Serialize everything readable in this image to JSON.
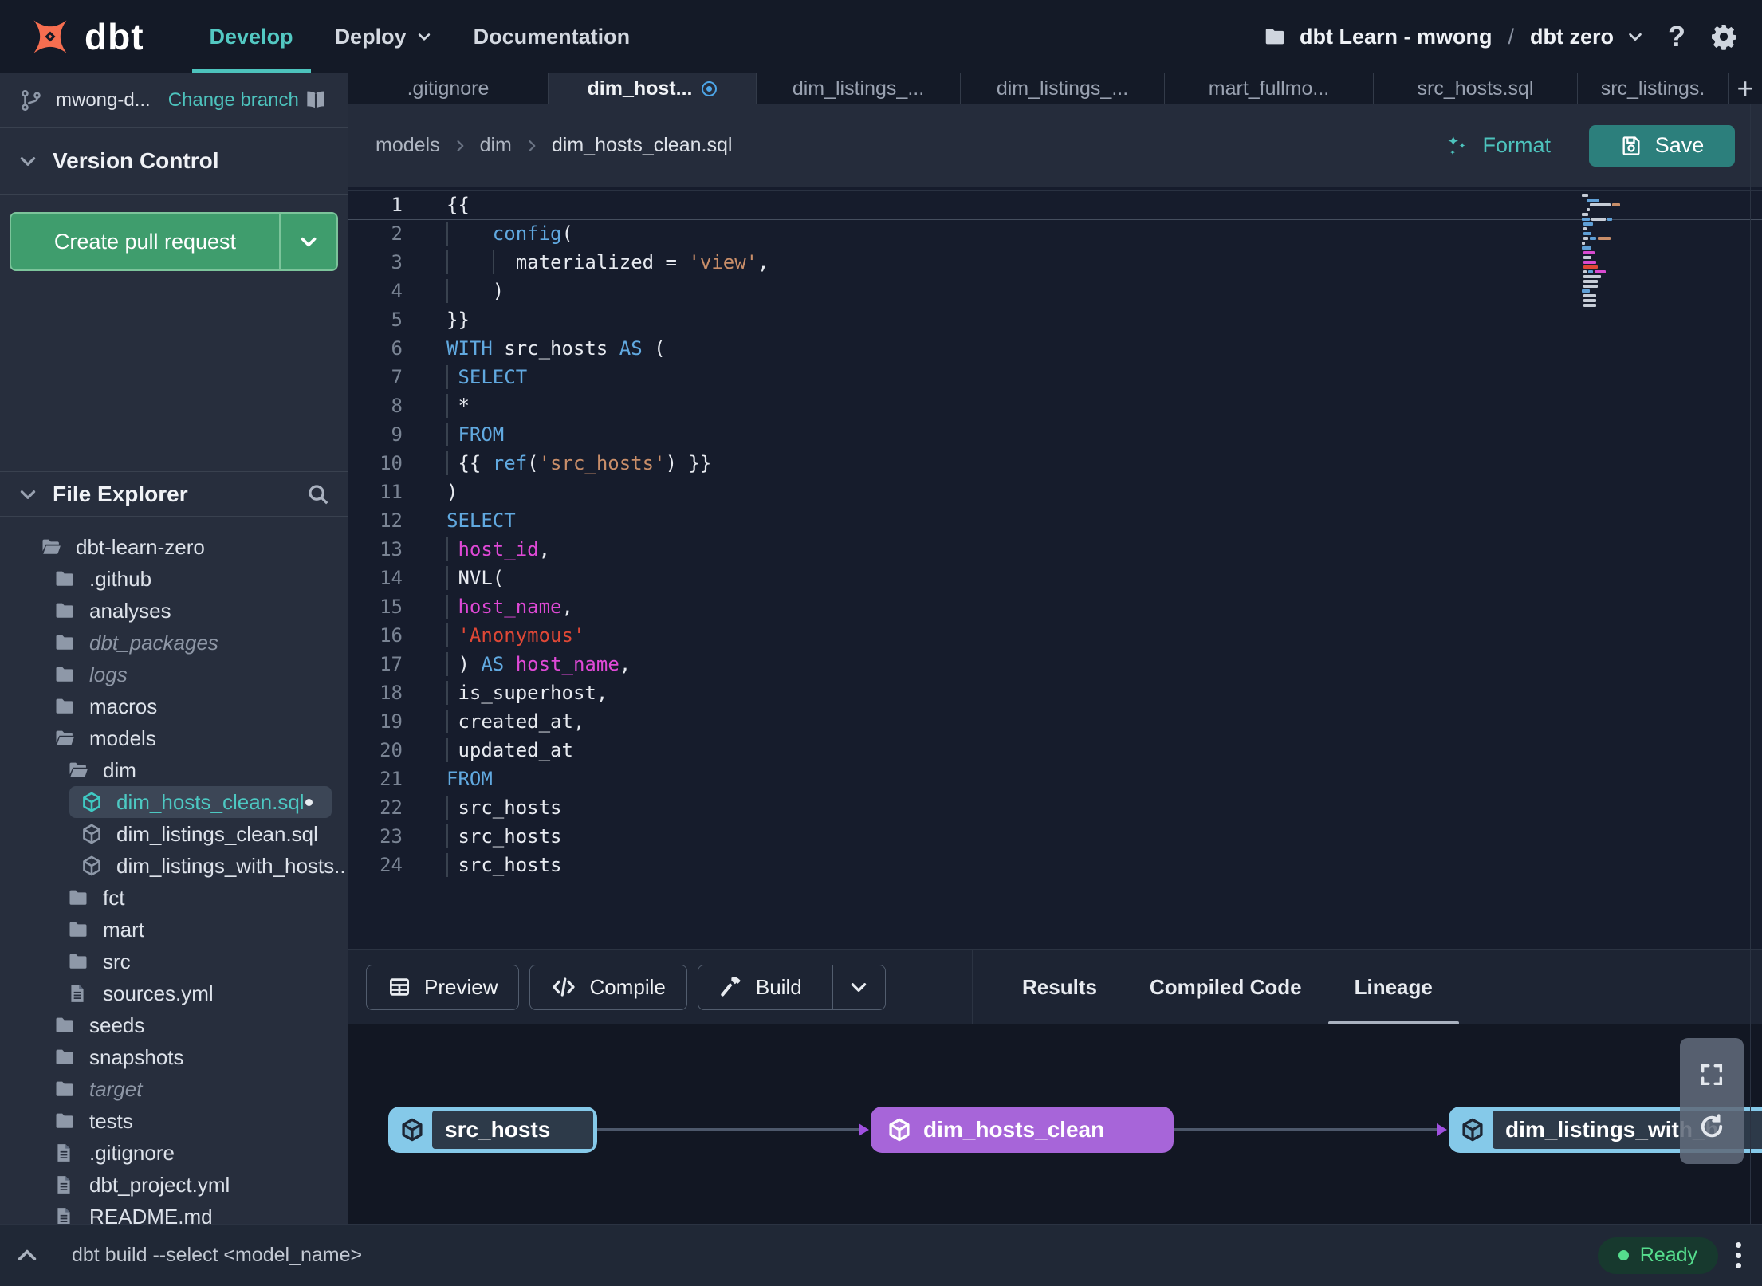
{
  "navbar": {
    "logo_text": "dbt",
    "nav_items": [
      "Develop",
      "Deploy",
      "Documentation"
    ],
    "active_nav": "Develop",
    "project_label": "dbt Learn - mwong",
    "project_separator": "/",
    "environment_label": "dbt zero"
  },
  "sidebar": {
    "branch": {
      "name": "mwong-d...",
      "change_link": "Change branch"
    },
    "version_control_header": "Version Control",
    "create_pr_label": "Create pull request",
    "file_explorer_header": "File Explorer",
    "tree": [
      {
        "label": "dbt-learn-zero",
        "type": "folder-open",
        "indent": 0
      },
      {
        "label": ".github",
        "type": "folder",
        "indent": 1
      },
      {
        "label": "analyses",
        "type": "folder",
        "indent": 1
      },
      {
        "label": "dbt_packages",
        "type": "folder",
        "indent": 1,
        "muted": true
      },
      {
        "label": "logs",
        "type": "folder",
        "indent": 1,
        "muted": true
      },
      {
        "label": "macros",
        "type": "folder",
        "indent": 1
      },
      {
        "label": "models",
        "type": "folder-open",
        "indent": 1
      },
      {
        "label": "dim",
        "type": "folder-open",
        "indent": 2
      },
      {
        "label": "dim_hosts_clean.sql",
        "type": "model",
        "indent": 3,
        "selected": true,
        "modified": true
      },
      {
        "label": "dim_listings_clean.sql",
        "type": "model",
        "indent": 3
      },
      {
        "label": "dim_listings_with_hosts...",
        "type": "model",
        "indent": 3
      },
      {
        "label": "fct",
        "type": "folder",
        "indent": 2
      },
      {
        "label": "mart",
        "type": "folder",
        "indent": 2
      },
      {
        "label": "src",
        "type": "folder",
        "indent": 2
      },
      {
        "label": "sources.yml",
        "type": "file",
        "indent": 2
      },
      {
        "label": "seeds",
        "type": "folder",
        "indent": 1
      },
      {
        "label": "snapshots",
        "type": "folder",
        "indent": 1
      },
      {
        "label": "target",
        "type": "folder",
        "indent": 1,
        "muted": true
      },
      {
        "label": "tests",
        "type": "folder",
        "indent": 1
      },
      {
        "label": ".gitignore",
        "type": "file",
        "indent": 1
      },
      {
        "label": "dbt_project.yml",
        "type": "file",
        "indent": 1
      },
      {
        "label": "README.md",
        "type": "file",
        "indent": 1
      }
    ]
  },
  "tabs": [
    {
      "label": ".gitignore"
    },
    {
      "label": "dim_host...",
      "active": true,
      "modified": true
    },
    {
      "label": "dim_listings_..."
    },
    {
      "label": "dim_listings_..."
    },
    {
      "label": "mart_fullmo..."
    },
    {
      "label": "src_hosts.sql"
    },
    {
      "label": "src_listings."
    }
  ],
  "editor_header": {
    "breadcrumb": [
      "models",
      "dim",
      "dim_hosts_clean.sql"
    ],
    "format_label": "Format",
    "save_label": "Save"
  },
  "editor": {
    "active_line": 1,
    "lines": [
      {
        "n": 1,
        "t": [
          [
            "w",
            "{{"
          ]
        ],
        "g": []
      },
      {
        "n": 2,
        "t": [
          [
            "w",
            "    "
          ],
          [
            "k",
            "config"
          ],
          [
            "w",
            "("
          ]
        ],
        "g": [
          0
        ]
      },
      {
        "n": 3,
        "t": [
          [
            "w",
            "      materialized = "
          ],
          [
            "s",
            "'view'"
          ],
          [
            "w",
            ","
          ]
        ],
        "g": [
          0,
          4
        ]
      },
      {
        "n": 4,
        "t": [
          [
            "w",
            "    )"
          ]
        ],
        "g": [
          0
        ]
      },
      {
        "n": 5,
        "t": [
          [
            "w",
            "}}"
          ]
        ],
        "g": []
      },
      {
        "n": 6,
        "t": [
          [
            "k",
            "WITH"
          ],
          [
            "w",
            " src_hosts "
          ],
          [
            "k",
            "AS"
          ],
          [
            "w",
            " ("
          ]
        ],
        "g": []
      },
      {
        "n": 7,
        "t": [
          [
            "w",
            " "
          ],
          [
            "k",
            "SELECT"
          ]
        ],
        "g": [
          0
        ]
      },
      {
        "n": 8,
        "t": [
          [
            "w",
            " *"
          ]
        ],
        "g": [
          0
        ]
      },
      {
        "n": 9,
        "t": [
          [
            "w",
            " "
          ],
          [
            "k",
            "FROM"
          ]
        ],
        "g": [
          0
        ]
      },
      {
        "n": 10,
        "t": [
          [
            "w",
            " {{ "
          ],
          [
            "k",
            "ref"
          ],
          [
            "w",
            "("
          ],
          [
            "s",
            "'src_hosts'"
          ],
          [
            "w",
            ") }}"
          ]
        ],
        "g": [
          0
        ]
      },
      {
        "n": 11,
        "t": [
          [
            "w",
            ")"
          ]
        ],
        "g": []
      },
      {
        "n": 12,
        "t": [
          [
            "k",
            "SELECT"
          ]
        ],
        "g": []
      },
      {
        "n": 13,
        "t": [
          [
            "w",
            " "
          ],
          [
            "m",
            "host_id"
          ],
          [
            "w",
            ","
          ]
        ],
        "g": [
          0
        ]
      },
      {
        "n": 14,
        "t": [
          [
            "w",
            " NVL("
          ]
        ],
        "g": [
          0
        ]
      },
      {
        "n": 15,
        "t": [
          [
            "w",
            " "
          ],
          [
            "m",
            "host_name"
          ],
          [
            "w",
            ","
          ]
        ],
        "g": [
          0
        ]
      },
      {
        "n": 16,
        "t": [
          [
            "w",
            " "
          ],
          [
            "r",
            "'Anonymous'"
          ]
        ],
        "g": [
          0
        ]
      },
      {
        "n": 17,
        "t": [
          [
            "w",
            " ) "
          ],
          [
            "k",
            "AS"
          ],
          [
            "w",
            " "
          ],
          [
            "m",
            "host_name"
          ],
          [
            "w",
            ","
          ]
        ],
        "g": [
          0
        ]
      },
      {
        "n": 18,
        "t": [
          [
            "w",
            " is_superhost,"
          ]
        ],
        "g": [
          0
        ]
      },
      {
        "n": 19,
        "t": [
          [
            "w",
            " created_at,"
          ]
        ],
        "g": [
          0
        ]
      },
      {
        "n": 20,
        "t": [
          [
            "w",
            " updated_at"
          ]
        ],
        "g": [
          0
        ]
      },
      {
        "n": 21,
        "t": [
          [
            "k",
            "FROM"
          ]
        ],
        "g": []
      },
      {
        "n": 22,
        "t": [
          [
            "w",
            " src_hosts"
          ]
        ],
        "g": [
          0
        ]
      },
      {
        "n": 23,
        "t": [
          [
            "w",
            " src_hosts"
          ]
        ],
        "g": [
          0
        ]
      },
      {
        "n": 24,
        "t": [
          [
            "w",
            " src_hosts"
          ]
        ],
        "g": [
          0
        ]
      }
    ],
    "minimap": [
      {
        "indent": 0,
        "segs": [
          [
            "w",
            8
          ]
        ]
      },
      {
        "indent": 6,
        "segs": [
          [
            "b",
            16
          ]
        ]
      },
      {
        "indent": 10,
        "segs": [
          [
            "w",
            26
          ],
          [
            "o",
            10
          ]
        ]
      },
      {
        "indent": 6,
        "segs": [
          [
            "w",
            4
          ]
        ]
      },
      {
        "indent": 0,
        "segs": [
          [
            "w",
            8
          ]
        ]
      },
      {
        "indent": 0,
        "segs": [
          [
            "b",
            10
          ],
          [
            "w",
            18
          ],
          [
            "b",
            6
          ]
        ]
      },
      {
        "indent": 2,
        "segs": [
          [
            "b",
            12
          ]
        ]
      },
      {
        "indent": 2,
        "segs": [
          [
            "w",
            4
          ]
        ]
      },
      {
        "indent": 2,
        "segs": [
          [
            "b",
            10
          ]
        ]
      },
      {
        "indent": 2,
        "segs": [
          [
            "w",
            6
          ],
          [
            "b",
            8
          ],
          [
            "o",
            16
          ]
        ]
      },
      {
        "indent": 0,
        "segs": [
          [
            "w",
            4
          ]
        ]
      },
      {
        "indent": 0,
        "segs": [
          [
            "b",
            12
          ]
        ]
      },
      {
        "indent": 2,
        "segs": [
          [
            "m",
            14
          ]
        ]
      },
      {
        "indent": 2,
        "segs": [
          [
            "w",
            10
          ]
        ]
      },
      {
        "indent": 2,
        "segs": [
          [
            "m",
            16
          ]
        ]
      },
      {
        "indent": 2,
        "segs": [
          [
            "r",
            18
          ]
        ]
      },
      {
        "indent": 2,
        "segs": [
          [
            "w",
            4
          ],
          [
            "b",
            6
          ],
          [
            "m",
            14
          ]
        ]
      },
      {
        "indent": 2,
        "segs": [
          [
            "w",
            22
          ]
        ]
      },
      {
        "indent": 2,
        "segs": [
          [
            "w",
            18
          ]
        ]
      },
      {
        "indent": 2,
        "segs": [
          [
            "w",
            18
          ]
        ]
      },
      {
        "indent": 0,
        "segs": [
          [
            "b",
            10
          ]
        ]
      },
      {
        "indent": 2,
        "segs": [
          [
            "w",
            16
          ]
        ]
      },
      {
        "indent": 2,
        "segs": [
          [
            "w",
            16
          ]
        ]
      },
      {
        "indent": 2,
        "segs": [
          [
            "w",
            16
          ]
        ]
      }
    ]
  },
  "bottom_panel": {
    "buttons": [
      {
        "label": "Preview",
        "icon": "table-icon"
      },
      {
        "label": "Compile",
        "icon": "code-icon"
      },
      {
        "label": "Build",
        "icon": "hammer-icon",
        "split": true
      }
    ],
    "tabs": [
      "Results",
      "Compiled Code",
      "Lineage"
    ],
    "active_tab": "Lineage"
  },
  "lineage": {
    "nodes": [
      {
        "label": "src_hosts",
        "style": "source"
      },
      {
        "label": "dim_hosts_clean",
        "style": "model"
      },
      {
        "label": "dim_listings_with_h",
        "style": "source"
      }
    ]
  },
  "statusbar": {
    "command_hint": "dbt build --select <model_name>",
    "status_label": "Ready"
  },
  "colors": {
    "accent_teal": "#4dc3bd",
    "pr_green": "#3f9d6d",
    "save_teal": "#2c7f7c",
    "node_blue": "#85c9e9",
    "node_purple": "#a765d9",
    "arrowhead_purple": "#a050e0",
    "ready_green": "#55dd8d",
    "code_keyword": "#61a9e0",
    "code_string": "#c98e69",
    "code_red_string": "#e04836",
    "code_identifier": "#df49d6",
    "modified_blue": "#4da6e8"
  }
}
